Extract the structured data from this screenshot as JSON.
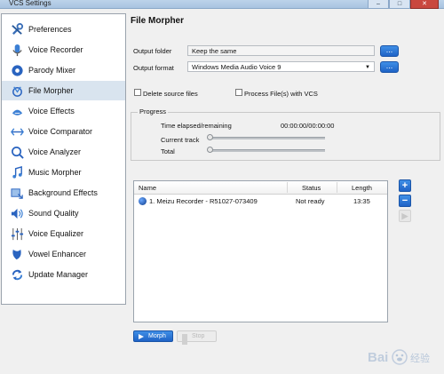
{
  "window": {
    "title": "VCS Settings",
    "controls": [
      "–",
      "□",
      "✕"
    ]
  },
  "sidebar": {
    "items": [
      {
        "label": "Preferences",
        "icon": "wrench-icon"
      },
      {
        "label": "Voice Recorder",
        "icon": "microphone-icon"
      },
      {
        "label": "Parody Mixer",
        "icon": "mixer-icon"
      },
      {
        "label": "File Morpher",
        "icon": "file-morpher-icon",
        "selected": true
      },
      {
        "label": "Voice Effects",
        "icon": "voice-effects-icon"
      },
      {
        "label": "Voice Comparator",
        "icon": "comparator-icon"
      },
      {
        "label": "Voice Analyzer",
        "icon": "analyzer-icon"
      },
      {
        "label": "Music Morpher",
        "icon": "music-note-icon"
      },
      {
        "label": "Background Effects",
        "icon": "background-effects-icon"
      },
      {
        "label": "Sound Quality",
        "icon": "speaker-icon"
      },
      {
        "label": "Voice Equalizer",
        "icon": "equalizer-icon"
      },
      {
        "label": "Vowel Enhancer",
        "icon": "vowel-enhancer-icon"
      },
      {
        "label": "Update Manager",
        "icon": "update-icon"
      }
    ]
  },
  "main": {
    "title": "File Morpher",
    "output_folder": {
      "label": "Output folder",
      "value": "Keep the same",
      "button": "..."
    },
    "output_format": {
      "label": "Output format",
      "value": "Windows Media Audio Voice 9",
      "button": "..."
    },
    "delete_source": {
      "label": "Delete source files",
      "checked": false
    },
    "process_vcs": {
      "label": "Process File(s) with VCS",
      "checked": false
    },
    "progress": {
      "legend": "Progress",
      "elapsed_label": "Time elapsed/remaining",
      "elapsed_value": "00:00:00/00:00:00",
      "current_track_label": "Current track",
      "current_track_value": 0,
      "total_label": "Total",
      "total_value": 0
    },
    "file_list": {
      "columns": [
        "Name",
        "Status",
        "Length"
      ],
      "rows": [
        {
          "name": "1. Meizu  Recorder - R51027-073409",
          "status": "Not ready",
          "length": "13:35"
        }
      ]
    },
    "list_buttons": {
      "add": "+",
      "remove": "−",
      "play": "▶"
    },
    "morph_button": "Morph",
    "stop_button": "Stop"
  },
  "watermark": {
    "text": "Bai百度",
    "sub": "经验"
  },
  "colors": {
    "accent": "#2670d6",
    "selected_nav": "#d9e4ef"
  }
}
